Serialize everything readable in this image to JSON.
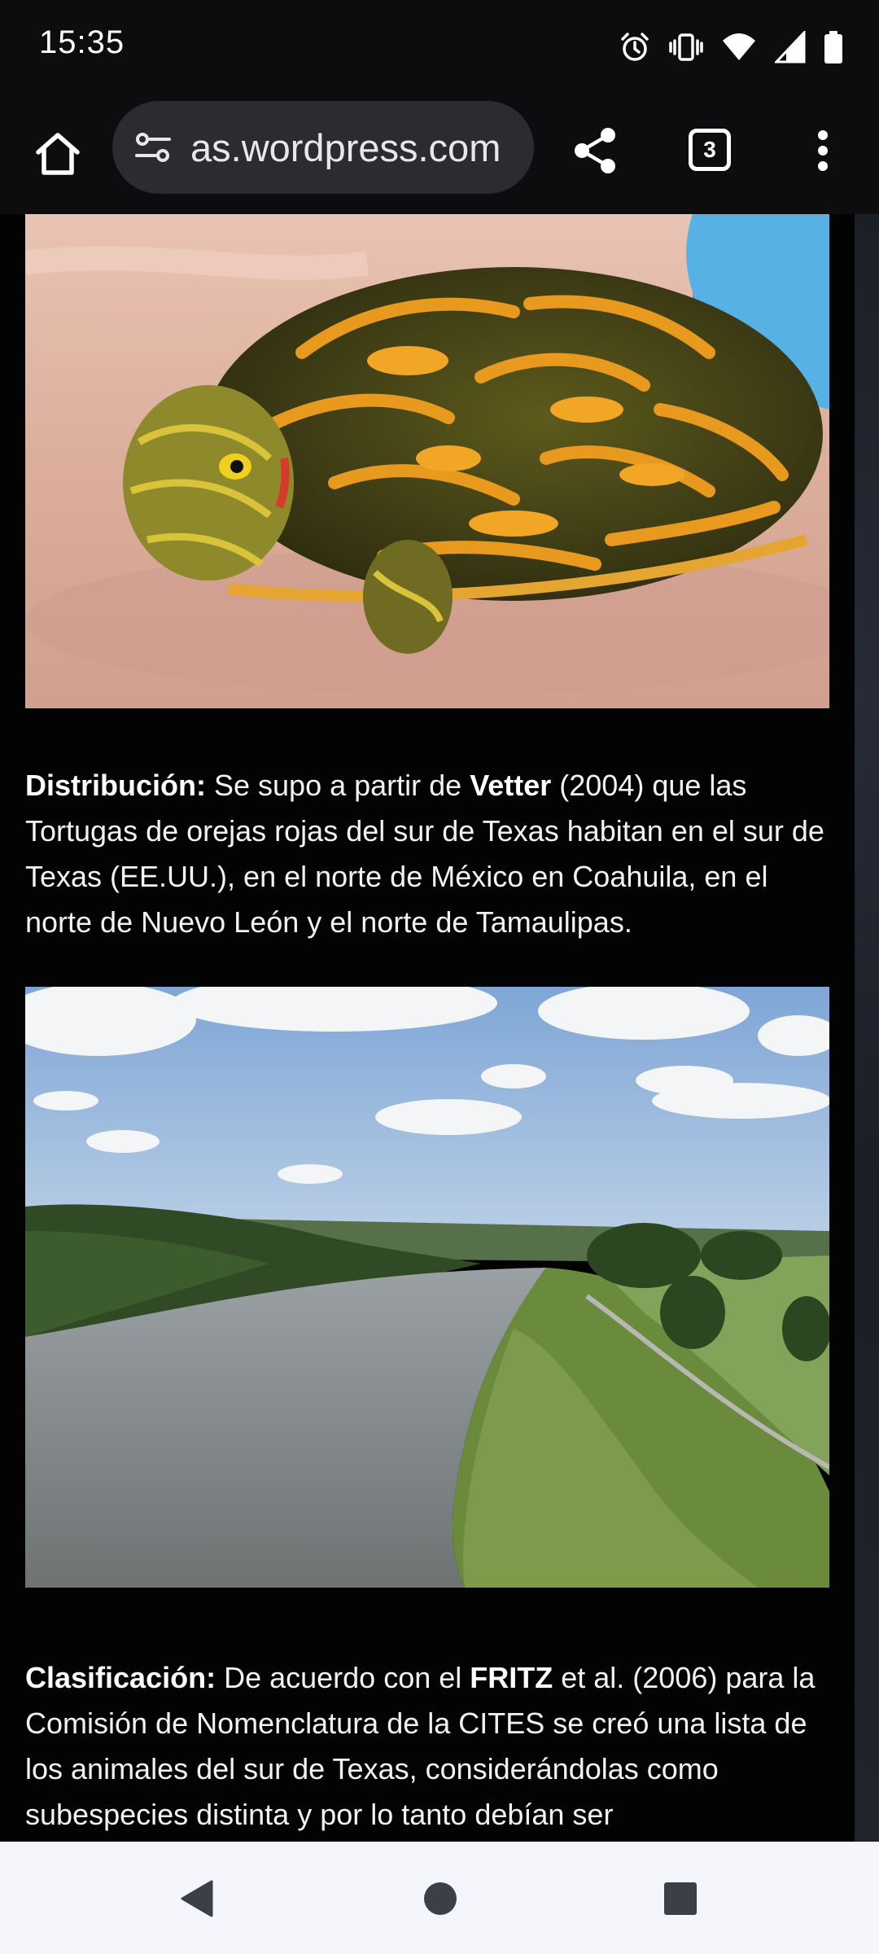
{
  "status_bar": {
    "time": "15:35",
    "icons": [
      "alarm-icon",
      "vibrate-icon",
      "wifi-icon",
      "signal-icon",
      "battery-icon"
    ]
  },
  "browser": {
    "url": "as.wordpress.com",
    "tab_count": "3",
    "icons": [
      "home-icon",
      "site-settings-icon",
      "share-icon",
      "tab-switcher-icon",
      "more-vert-icon"
    ]
  },
  "article": {
    "distribution": {
      "label": "Distribución:",
      "t1": " Se supo a partir de ",
      "author": "Vetter",
      "t2": " (2004) que las Tortugas de orejas rojas del sur de Texas habitan en el sur de Texas (EE.UU.), en el norte de México en Coahuila, en el norte de Nuevo León y el norte de Tamaulipas."
    },
    "classification": {
      "label": "Clasificación:",
      "t1": " De acuerdo con el ",
      "author": "FRITZ",
      "t2": " et al. (2006) para la Comisión de Nomenclatura de la CITES se creó una lista de los animales del sur de Texas, considerándolas como subespecies distinta y por lo tanto debían ser"
    }
  },
  "nav_bar": {
    "icons": [
      "back-icon",
      "home-circle-icon",
      "recents-icon"
    ]
  },
  "colors": {
    "status_bg": "#0d0d0f",
    "url_pill": "#2c2c30",
    "content_bg": "#030303",
    "nav_bg": "#f4f6fb",
    "nav_icon": "#3c3f46"
  }
}
